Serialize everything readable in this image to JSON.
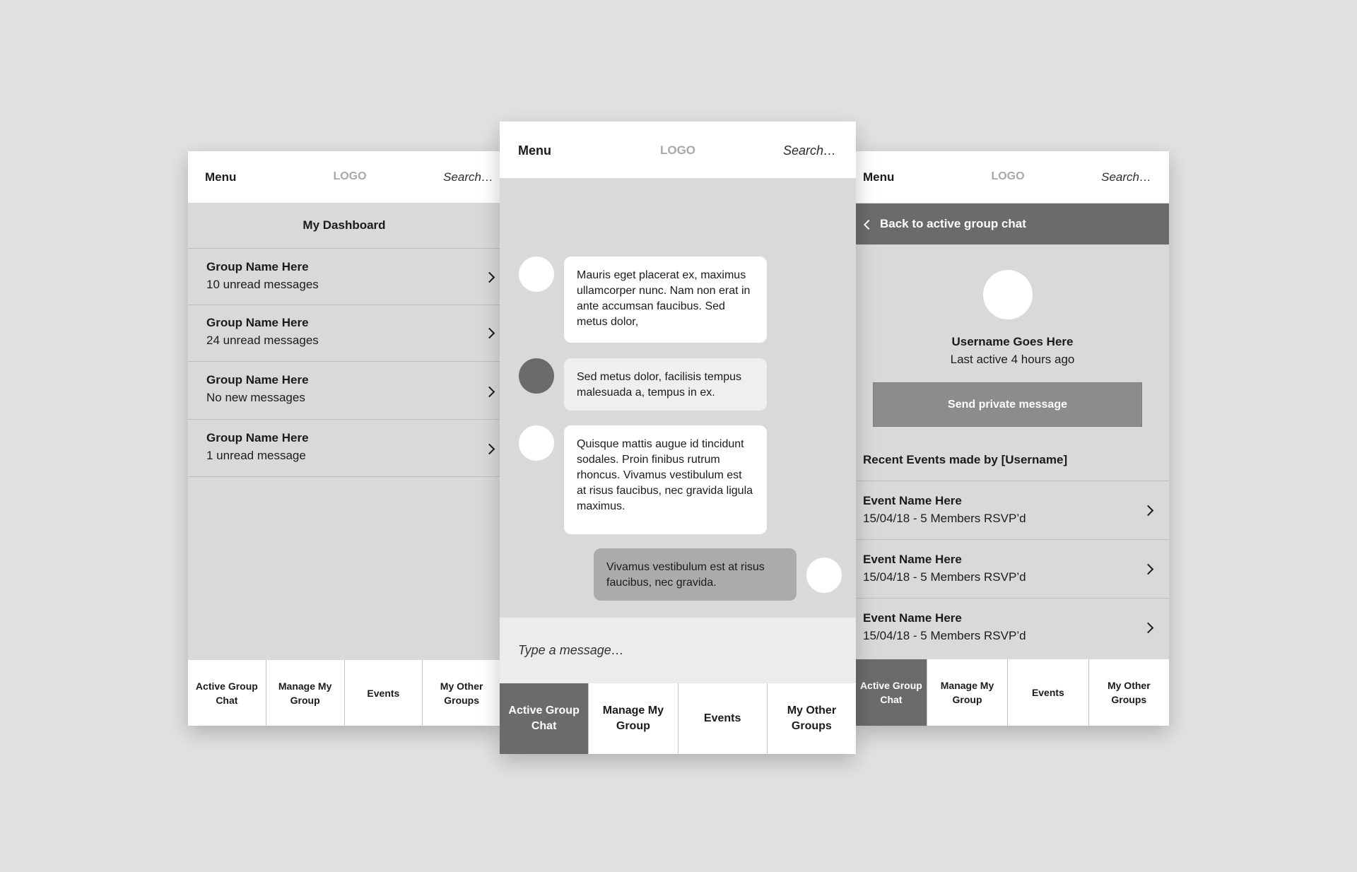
{
  "header": {
    "menu_label": "Menu",
    "logo_text": "LOGO",
    "search_placeholder": "Search…"
  },
  "tabs": [
    {
      "label": "Active Group\nChat",
      "active": true
    },
    {
      "label": "Manage My\nGroup",
      "active": false
    },
    {
      "label": "Events",
      "active": false
    },
    {
      "label": "My Other\nGroups",
      "active": false
    }
  ],
  "dashboard": {
    "title": "My Dashboard",
    "groups": [
      {
        "name": "Group Name Here",
        "status": "10 unread messages"
      },
      {
        "name": "Group Name Here",
        "status": "24 unread messages"
      },
      {
        "name": "Group Name Here",
        "status": "No new messages"
      },
      {
        "name": "Group Name Here",
        "status": "1 unread message"
      }
    ]
  },
  "chat": {
    "messages": [
      {
        "text": "Mauris eget placerat ex, maximus ullamcorper nunc. Nam non erat in ante accumsan faucibus. Sed metus dolor,"
      },
      {
        "text": "Sed metus dolor, facilisis tempus malesuada a, tempus in ex."
      },
      {
        "text": "Quisque mattis augue id tincidunt sodales. Proin finibus rutrum rhoncus. Vivamus vestibulum est at risus faucibus, nec gravida ligula maximus."
      },
      {
        "text": "Vivamus vestibulum est at risus faucibus, nec gravida."
      }
    ],
    "composer_placeholder": "Type a message…"
  },
  "profile": {
    "back_label": "Back to active group chat",
    "username": "Username Goes Here",
    "last_active": "Last active 4 hours ago",
    "send_button": "Send private message",
    "recent_title": "Recent Events made by [Username]",
    "events": [
      {
        "name": "Event Name Here",
        "details": "15/04/18 - 5 Members RSVP’d"
      },
      {
        "name": "Event Name Here",
        "details": "15/04/18 - 5 Members RSVP’d"
      },
      {
        "name": "Event Name Here",
        "details": "15/04/18 - 5 Members RSVP’d"
      }
    ]
  },
  "colors": {
    "background": "#e1e1e1",
    "screen": "#d9d9d9",
    "active_tab": "#6b6b6b",
    "button": "#8c8c8c"
  }
}
